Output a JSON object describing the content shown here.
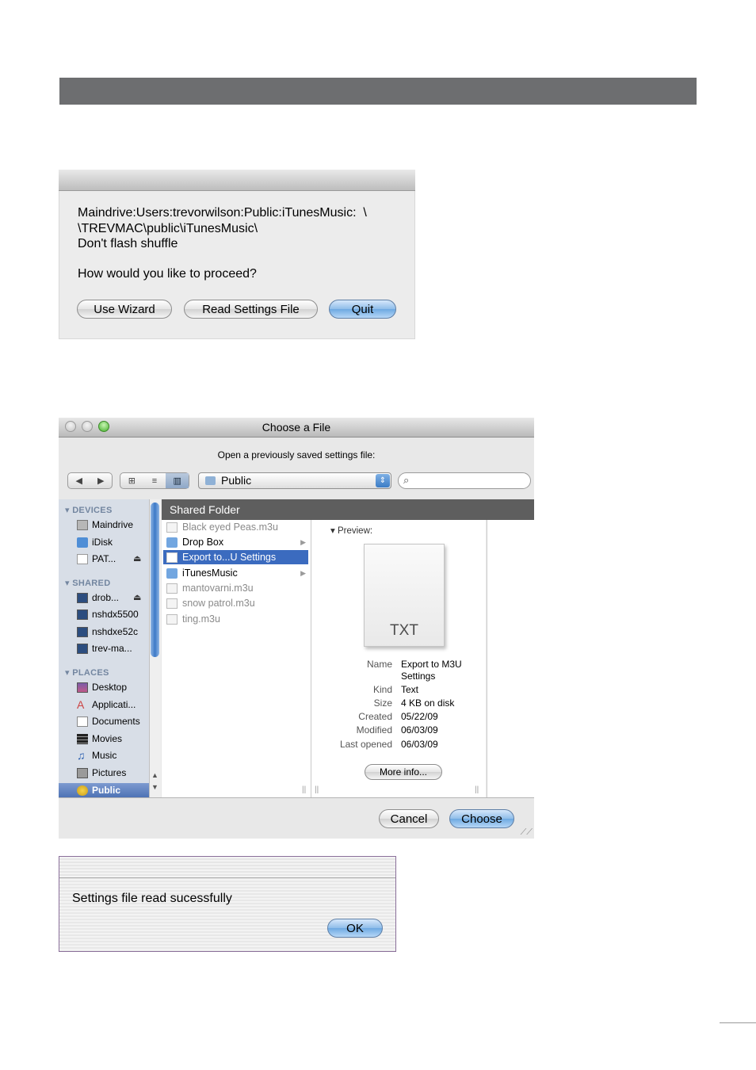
{
  "dialog_proceed": {
    "message_lines": [
      "Maindrive:Users:trevorwilson:Public:iTunesMusic:  \\",
      "\\TREVMAC\\public\\iTunesMusic\\",
      "Don't flash shuffle"
    ],
    "question": "How would you like to proceed?",
    "buttons": {
      "wizard": "Use Wizard",
      "read_settings": "Read Settings File",
      "quit": "Quit"
    }
  },
  "dialog_choose": {
    "title": "Choose a File",
    "prompt": "Open a previously saved settings file:",
    "location": "Public",
    "search": {
      "value": ""
    },
    "sidebar": {
      "devices_header": "DEVICES",
      "devices": [
        "Maindrive",
        "iDisk",
        "PAT..."
      ],
      "shared_header": "SHARED",
      "shared": [
        "drob...",
        "nshdx5500",
        "nshdxe52c",
        "trev-ma..."
      ],
      "places_header": "PLACES",
      "places": [
        "Desktop",
        "Applicati...",
        "Documents",
        "Movies",
        "Music",
        "Pictures",
        "Public"
      ]
    },
    "column_header": "Shared Folder",
    "files": [
      {
        "name": "Black eyed Peas.m3u",
        "type": "file",
        "dim": true
      },
      {
        "name": "Drop Box",
        "type": "folder",
        "dim": false
      },
      {
        "name": "Export to...U Settings",
        "type": "file",
        "dim": false,
        "selected": true
      },
      {
        "name": "iTunesMusic",
        "type": "folder",
        "dim": false
      },
      {
        "name": "mantovarni.m3u",
        "type": "file",
        "dim": true
      },
      {
        "name": "snow patrol.m3u",
        "type": "file",
        "dim": true
      },
      {
        "name": "ting.m3u",
        "type": "file",
        "dim": true
      }
    ],
    "preview": {
      "label": "Preview:",
      "doc_label": "TXT",
      "info": {
        "name_key": "Name",
        "name_value_1": "Export to M3U",
        "name_value_2": "Settings",
        "kind_key": "Kind",
        "kind_value": "Text",
        "size_key": "Size",
        "size_value": "4 KB on disk",
        "created_key": "Created",
        "created_value": "05/22/09",
        "modified_key": "Modified",
        "modified_value": "06/03/09",
        "opened_key": "Last opened",
        "opened_value": "06/03/09"
      },
      "more_info": "More info..."
    },
    "buttons": {
      "cancel": "Cancel",
      "choose": "Choose"
    }
  },
  "dialog_success": {
    "message": "Settings file read sucessfully",
    "ok": "OK"
  },
  "colors": {
    "header_bar": "#6d6e70",
    "selection": "#3b6bbf",
    "aqua_blue": "#6ea9e1"
  }
}
